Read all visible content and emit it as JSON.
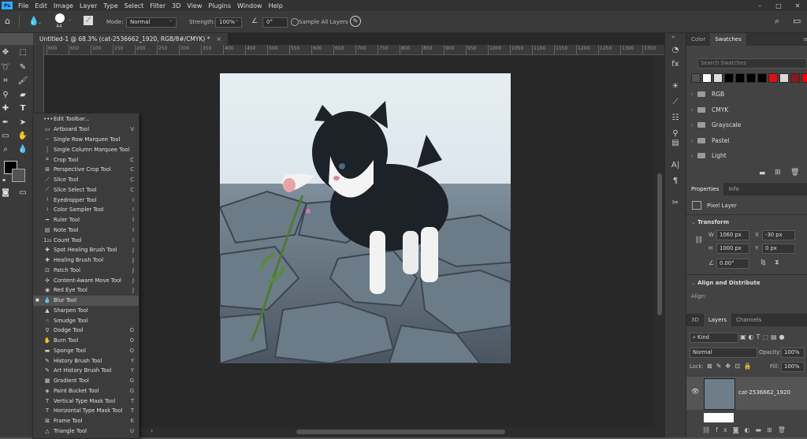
{
  "menubar": {
    "logo": "Ps",
    "items": [
      "File",
      "Edit",
      "Image",
      "Layer",
      "Type",
      "Select",
      "Filter",
      "3D",
      "View",
      "Plugins",
      "Window",
      "Help"
    ],
    "window_controls": [
      "–",
      "□",
      "✕"
    ]
  },
  "options": {
    "brush_size": "44",
    "mode_label": "Mode:",
    "mode_value": "Normal",
    "strength_label": "Strength:",
    "strength_value": "100%",
    "angle_value": "0°",
    "sample_all_label": "Sample All Layers"
  },
  "document": {
    "tab_title": "Untitled-1 @ 68.3% (cat-2536662_1920, RGB/8#/CMYK) *",
    "close": "×"
  },
  "ruler_ticks": [
    "600",
    "650",
    "100",
    "150",
    "200",
    "250",
    "300",
    "350",
    "400",
    "450",
    "500",
    "550",
    "600",
    "650",
    "700",
    "750",
    "800",
    "850",
    "900",
    "950",
    "1000",
    "1050",
    "1100",
    "1150",
    "1200",
    "1250",
    "1300",
    "1350",
    "1400"
  ],
  "flyout": {
    "edit_toolbar": "Edit Toolbar...",
    "items": [
      {
        "label": "Artboard Tool",
        "key": "V",
        "icon": "artboard-icon",
        "glyph": "▭"
      },
      {
        "label": "Single Row Marquee Tool",
        "key": "",
        "icon": "single-row-marquee-icon",
        "glyph": "┄"
      },
      {
        "label": "Single Column Marquee Tool",
        "key": "",
        "icon": "single-column-marquee-icon",
        "glyph": "┆"
      },
      {
        "label": "Crop Tool",
        "key": "C",
        "icon": "crop-icon",
        "glyph": "⌗"
      },
      {
        "label": "Perspective Crop Tool",
        "key": "C",
        "icon": "perspective-crop-icon",
        "glyph": "⊞"
      },
      {
        "label": "Slice Tool",
        "key": "C",
        "icon": "slice-icon",
        "glyph": "⟋"
      },
      {
        "label": "Slice Select Tool",
        "key": "C",
        "icon": "slice-select-icon",
        "glyph": "⟋"
      },
      {
        "label": "Eyedropper Tool",
        "key": "I",
        "icon": "eyedropper-icon",
        "glyph": "⟊"
      },
      {
        "label": "Color Sampler Tool",
        "key": "I",
        "icon": "color-sampler-icon",
        "glyph": "⟊"
      },
      {
        "label": "Ruler Tool",
        "key": "I",
        "icon": "ruler-icon",
        "glyph": "━"
      },
      {
        "label": "Note Tool",
        "key": "I",
        "icon": "note-icon",
        "glyph": "▤"
      },
      {
        "label": "Count Tool",
        "key": "I",
        "icon": "count-icon",
        "glyph": "1₂₃"
      },
      {
        "label": "Spot Healing Brush Tool",
        "key": "J",
        "icon": "spot-healing-icon",
        "glyph": "✚"
      },
      {
        "label": "Healing Brush Tool",
        "key": "J",
        "icon": "healing-brush-icon",
        "glyph": "✚"
      },
      {
        "label": "Patch Tool",
        "key": "J",
        "icon": "patch-icon",
        "glyph": "⊡"
      },
      {
        "label": "Content-Aware Move Tool",
        "key": "J",
        "icon": "content-aware-move-icon",
        "glyph": "✣"
      },
      {
        "label": "Red Eye Tool",
        "key": "J",
        "icon": "red-eye-icon",
        "glyph": "◉"
      },
      {
        "label": "Blur Tool",
        "key": "",
        "icon": "blur-icon",
        "glyph": "💧"
      },
      {
        "label": "Sharpen Tool",
        "key": "",
        "icon": "sharpen-icon",
        "glyph": "▲"
      },
      {
        "label": "Smudge Tool",
        "key": "",
        "icon": "smudge-icon",
        "glyph": "☝"
      },
      {
        "label": "Dodge Tool",
        "key": "O",
        "icon": "dodge-icon",
        "glyph": "⚲"
      },
      {
        "label": "Burn Tool",
        "key": "O",
        "icon": "burn-icon",
        "glyph": "✋"
      },
      {
        "label": "Sponge Tool",
        "key": "O",
        "icon": "sponge-icon",
        "glyph": "▬"
      },
      {
        "label": "History Brush Tool",
        "key": "Y",
        "icon": "history-brush-icon",
        "glyph": "✎"
      },
      {
        "label": "Art History Brush Tool",
        "key": "Y",
        "icon": "art-history-brush-icon",
        "glyph": "✎"
      },
      {
        "label": "Gradient Tool",
        "key": "G",
        "icon": "gradient-icon",
        "glyph": "▦"
      },
      {
        "label": "Paint Bucket Tool",
        "key": "G",
        "icon": "paint-bucket-icon",
        "glyph": "◈"
      },
      {
        "label": "Vertical Type Mask Tool",
        "key": "T",
        "icon": "vertical-type-mask-icon",
        "glyph": "T"
      },
      {
        "label": "Horizontal Type Mask Tool",
        "key": "T",
        "icon": "horizontal-type-mask-icon",
        "glyph": "T"
      },
      {
        "label": "Frame Tool",
        "key": "K",
        "icon": "frame-icon",
        "glyph": "⊠"
      },
      {
        "label": "Triangle Tool",
        "key": "U",
        "icon": "triangle-icon",
        "glyph": "△"
      }
    ],
    "selected_index": 17
  },
  "panels": {
    "color_tab": "Color",
    "swatches_tab": "Swatches",
    "search_placeholder": "Search Swatches",
    "swatch_colors": [
      "#535353",
      "#ffffff",
      "#dcdcdc",
      "#000000",
      "#000000",
      "#000000",
      "#000000",
      "#e01010",
      "#d9d9d9",
      "#8a1a1a",
      "#ff0000"
    ],
    "swatch_groups": [
      "RGB",
      "CMYK",
      "Grayscale",
      "Pastel",
      "Light"
    ],
    "properties_tab": "Properties",
    "info_tab": "Info",
    "pixel_layer": "Pixel Layer",
    "transform": "Transform",
    "w_label": "W",
    "w_value": "1060 px",
    "h_label": "H",
    "h_value": "1000 px",
    "x_label": "X",
    "x_value": "-30 px",
    "y_label": "Y",
    "y_value": "0 px",
    "angle_value": "0.00°",
    "align_distribute": "Align and Distribute",
    "align_label": "Align:",
    "tab_3d": "3D",
    "tab_layers": "Layers",
    "tab_channels": "Channels",
    "kind_value": "Kind",
    "blend_mode": "Normal",
    "opacity_label": "Opacity:",
    "opacity_value": "100%",
    "lock_label": "Lock:",
    "fill_label": "Fill:",
    "fill_value": "100%",
    "layer_name": "cat-2536662_1920"
  }
}
